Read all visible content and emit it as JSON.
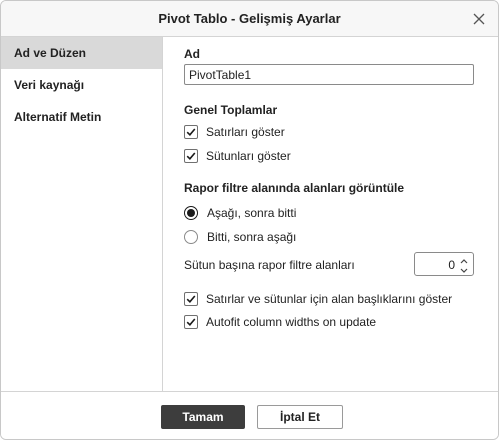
{
  "dialog": {
    "title": "Pivot Tablo - Gelişmiş Ayarlar"
  },
  "sidebar": {
    "items": [
      {
        "label": "Ad ve Düzen",
        "active": true
      },
      {
        "label": "Veri kaynağı",
        "active": false
      },
      {
        "label": "Alternatif Metin",
        "active": false
      }
    ]
  },
  "name_section": {
    "heading": "Ad",
    "value": "PivotTable1"
  },
  "grand_totals": {
    "heading": "Genel Toplamlar",
    "show_rows": {
      "label": "Satırları göster",
      "checked": true
    },
    "show_columns": {
      "label": "Sütunları göster",
      "checked": true
    }
  },
  "report_filter": {
    "heading": "Rapor filtre alanında alanları görüntüle",
    "down_then_over": {
      "label": "Aşağı, sonra bitti",
      "selected": true
    },
    "over_then_down": {
      "label": "Bitti, sonra aşağı",
      "selected": false
    },
    "fields_per_column_label": "Sütun başına rapor filtre alanları",
    "fields_per_column_value": "0"
  },
  "options": {
    "field_headers": {
      "label": "Satırlar ve sütunlar için alan başlıklarını göster",
      "checked": true
    },
    "autofit": {
      "label": "Autofit column widths on update",
      "checked": true
    }
  },
  "footer": {
    "ok_label": "Tamam",
    "cancel_label": "İptal Et"
  },
  "icons": {
    "close": "close-icon",
    "check": "check-icon",
    "spin_up": "chevron-up-icon",
    "spin_down": "chevron-down-icon"
  },
  "colors": {
    "primary_button": "#3d3d3d",
    "active_sidebar": "#d9d9d9",
    "border": "#d4d4d4"
  }
}
